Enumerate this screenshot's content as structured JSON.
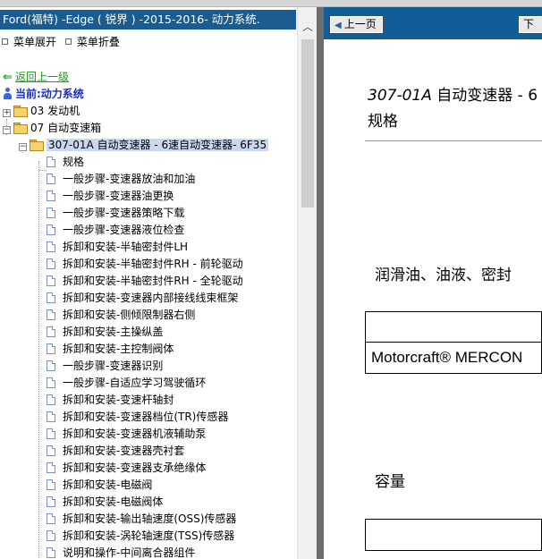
{
  "left_pane": {
    "title": "Ford(福特) -Edge ( 锐界 ) -2015-2016- 动力系统.",
    "menu": {
      "expand": "菜单展开",
      "collapse": "菜单折叠"
    },
    "back_link": "返回上一级",
    "current_label": "当前:动力系统",
    "tree": {
      "engine": {
        "expander": "+",
        "label": "03 发动机"
      },
      "transmission": {
        "expander": "−",
        "label": "07 自动变速箱"
      },
      "selected": {
        "expander": "−",
        "label": "307-01A 自动变速器 - 6速自动变速器- 6F35"
      },
      "items": [
        "规格",
        "一般步骤-变速器放油和加油",
        "一般步骤-变速器油更换",
        "一般步骤-变速器策略下载",
        "一般步骤-变速器液位检查",
        "拆卸和安装-半轴密封件LH",
        "拆卸和安装-半轴密封件RH - 前轮驱动",
        "拆卸和安装-半轴密封件RH - 全轮驱动",
        "拆卸和安装-变速器内部接线线束框架",
        "拆卸和安装-侧倾限制器右侧",
        "拆卸和安装-主操纵盖",
        "拆卸和安装-主控制阀体",
        "一般步骤-变速器识别",
        "一般步骤-自适应学习驾驶循环",
        "拆卸和安装-变速杆轴封",
        "拆卸和安装-变速器档位(TR)传感器",
        "拆卸和安装-变速器机液辅助泵",
        "拆卸和安装-变速器壳衬套",
        "拆卸和安装-变速器支承绝缘体",
        "拆卸和安装-电磁阀",
        "拆卸和安装-电磁阀体",
        "拆卸和安装-输出轴速度(OSS)传感器",
        "拆卸和安装-涡轮轴速度(TSS)传感器",
        "说明和操作-中间离合器组件"
      ]
    }
  },
  "right_pane": {
    "prev_button": "上一页",
    "next_button": "下",
    "doc_title_code": "307-01A",
    "doc_title_rest": " 自动变速器 - 6",
    "doc_subtitle": "规格",
    "section_fluids": "润滑油、油液、密封",
    "table1": [
      "",
      "Motorcraft® MERCON"
    ],
    "section_capacity": "容量",
    "table2": [
      ""
    ]
  },
  "colors": {
    "title_bar": "#1a5c8f",
    "nav_bar": "#115d97",
    "selection": "#c9d8ee",
    "back_link": "#18a018",
    "current_label": "#1a2fc4",
    "divider": "#6e6e6e"
  }
}
